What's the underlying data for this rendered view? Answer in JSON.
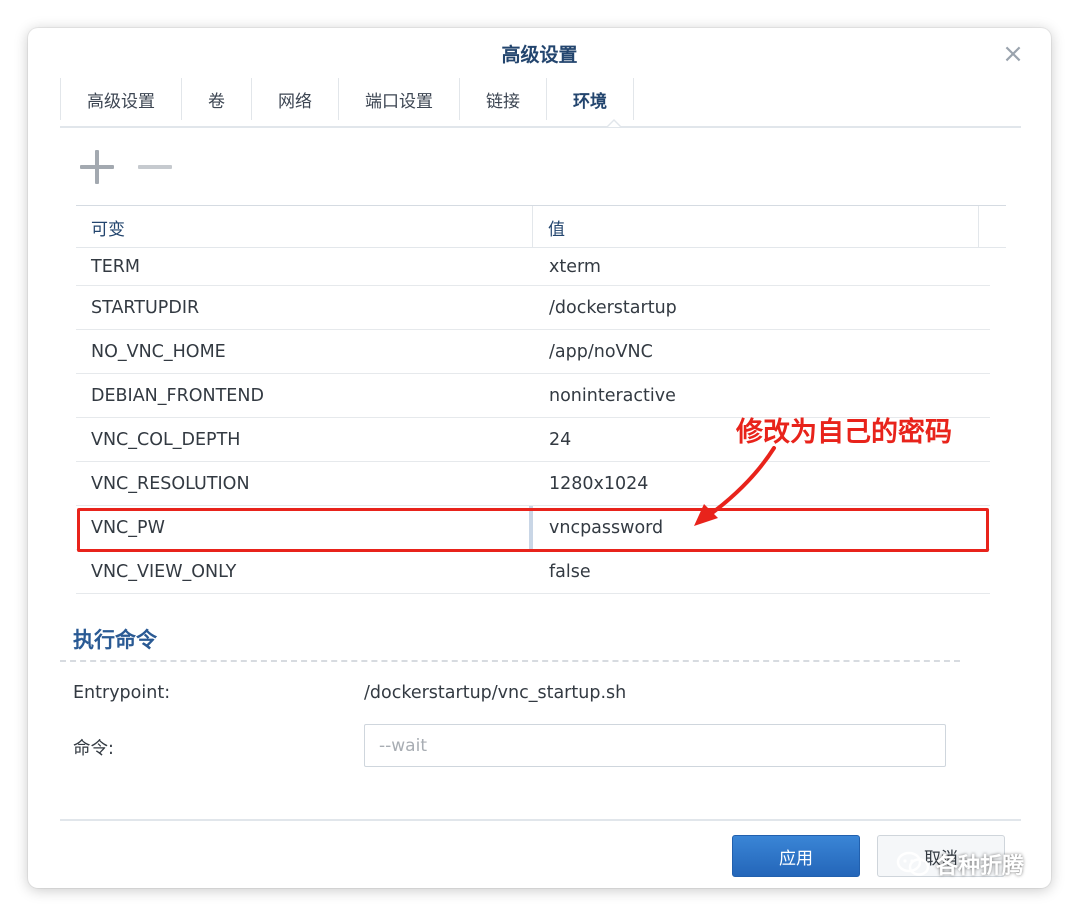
{
  "dialog": {
    "title": "高级设置",
    "close_glyph": "×"
  },
  "tabs": [
    {
      "label": "高级设置",
      "active": false
    },
    {
      "label": "卷",
      "active": false
    },
    {
      "label": "网络",
      "active": false
    },
    {
      "label": "端口设置",
      "active": false
    },
    {
      "label": "链接",
      "active": false
    },
    {
      "label": "环境",
      "active": true
    }
  ],
  "toolbar": {
    "add_icon": "plus-icon",
    "remove_icon": "minus-icon"
  },
  "table": {
    "columns": [
      "可变",
      "值"
    ],
    "rows": [
      {
        "key": "TERM",
        "value": "xterm"
      },
      {
        "key": "STARTUPDIR",
        "value": "/dockerstartup"
      },
      {
        "key": "NO_VNC_HOME",
        "value": "/app/noVNC"
      },
      {
        "key": "DEBIAN_FRONTEND",
        "value": "noninteractive"
      },
      {
        "key": "VNC_COL_DEPTH",
        "value": "24"
      },
      {
        "key": "VNC_RESOLUTION",
        "value": "1280x1024"
      },
      {
        "key": "VNC_PW",
        "value": "vncpassword"
      },
      {
        "key": "VNC_VIEW_ONLY",
        "value": "false"
      }
    ]
  },
  "annotation": {
    "text": "修改为自己的密码",
    "color": "#e8231b"
  },
  "exec": {
    "section_title": "执行命令",
    "entrypoint_label": "Entrypoint:",
    "entrypoint_value": "/dockerstartup/vnc_startup.sh",
    "command_label": "命令:",
    "command_placeholder": "--wait"
  },
  "footer": {
    "apply_label": "应用",
    "cancel_label": "取消"
  },
  "watermark": {
    "text": "各种折腾"
  },
  "colors": {
    "accent": "#2466b9",
    "title": "#23456e",
    "highlight": "#e8231b"
  }
}
